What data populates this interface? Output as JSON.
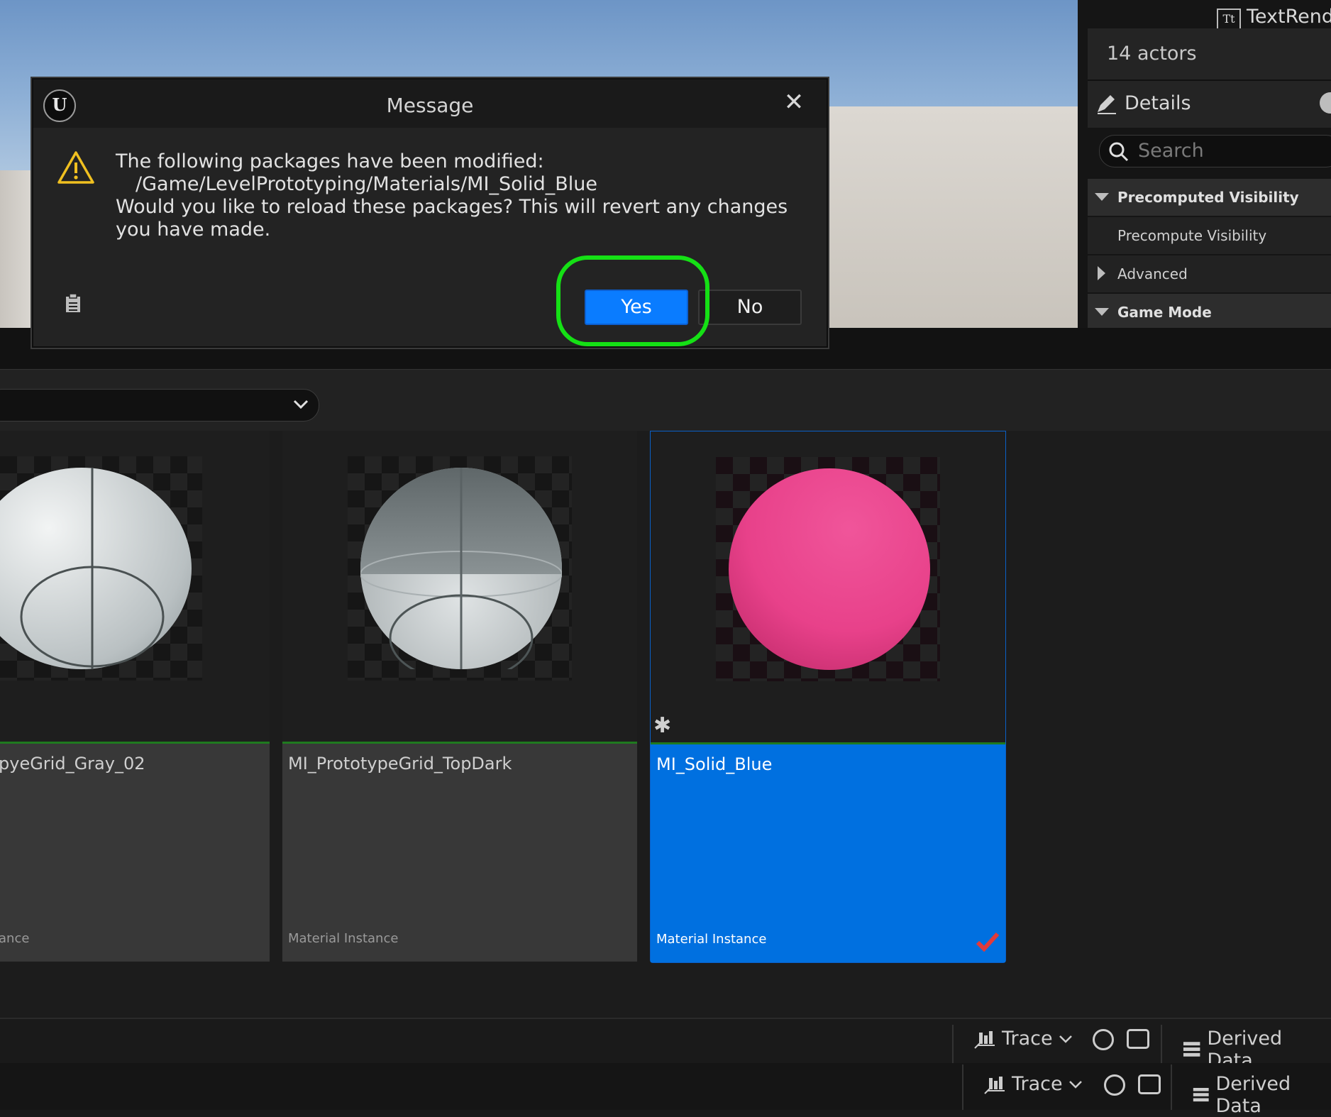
{
  "dialog": {
    "title": "Message",
    "line1": "The following packages have been modified:",
    "line2": "/Game/LevelPrototyping/Materials/MI_Solid_Blue",
    "line3": "Would you like to reload these packages? This will revert any changes you have made.",
    "yes_label": "Yes",
    "no_label": "No",
    "highlight_color": "#15e015"
  },
  "right_panel": {
    "textrender_label": "TextRender",
    "actors_count": "14 actors",
    "details_title": "Details",
    "search_placeholder": "Search",
    "categories": [
      {
        "label": "Precomputed Visibility",
        "expanded": true
      },
      {
        "label": "Precompute Visibility"
      },
      {
        "label": "Advanced",
        "expanded": false
      },
      {
        "label": "Game Mode",
        "expanded": true
      }
    ]
  },
  "assets": [
    {
      "name": "pyeGrid_Gray_02",
      "type": "ance"
    },
    {
      "name": "MI_PrototypeGrid_TopDark",
      "type": "Material Instance"
    },
    {
      "name": "MI_Solid_Blue",
      "type": "Material Instance",
      "selected": true,
      "modified": true,
      "color": "#e8418a"
    }
  ],
  "status_bar": {
    "row1": {
      "trace": "Trace",
      "derived": "Derived Data"
    },
    "row2": {
      "trace": "Trace",
      "derived": "Derived Data"
    }
  },
  "colors": {
    "accent": "#0a7cff",
    "selected_tile": "#0070e0",
    "sphere_pink": "#e8418a"
  }
}
